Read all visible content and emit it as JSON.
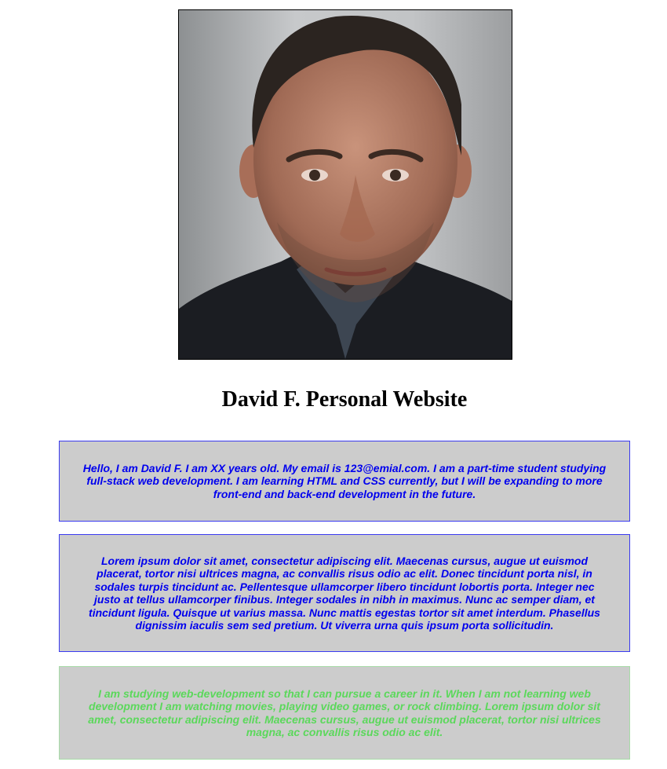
{
  "profile": {
    "photo_alt": "Portrait photo of David F."
  },
  "header": {
    "title": "David F. Personal Website"
  },
  "sections": {
    "intro": "Hello, I am David F. I am XX years old. My email is 123@emial.com. I am a part-time student studying full-stack web development. I am learning HTML and CSS currently, but I will be expanding to more front-end and back-end development in the future.",
    "lorem": "Lorem ipsum dolor sit amet, consectetur adipiscing elit. Maecenas cursus, augue ut euismod placerat, tortor nisi ultrices magna, ac convallis risus odio ac elit. Donec tincidunt porta nisl, in sodales turpis tincidunt ac. Pellentesque ullamcorper libero tincidunt lobortis porta. Integer nec justo at tellus ullamcorper finibus. Integer sodales in nibh in maximus. Nunc ac semper diam, et tincidunt ligula. Quisque ut varius massa. Nunc mattis egestas tortor sit amet interdum. Phasellus dignissim iaculis sem sed pretium. Ut viverra urna quis ipsum porta sollicitudin.",
    "study": "I am studying web-development so that I can pursue a career in it. When I am not learning web development I am watching movies, playing video games, or rock climbing. Lorem ipsum dolor sit amet, consectetur adipiscing elit. Maecenas cursus, augue ut euismod placerat, tortor nisi ultrices magna, ac convallis risus odio ac elit."
  },
  "colors": {
    "box_background": "#cccccc",
    "text_blue": "#0000ee",
    "text_green": "#5bd85b",
    "border_blue": "#3a3af0",
    "border_green": "#a8dca8"
  }
}
